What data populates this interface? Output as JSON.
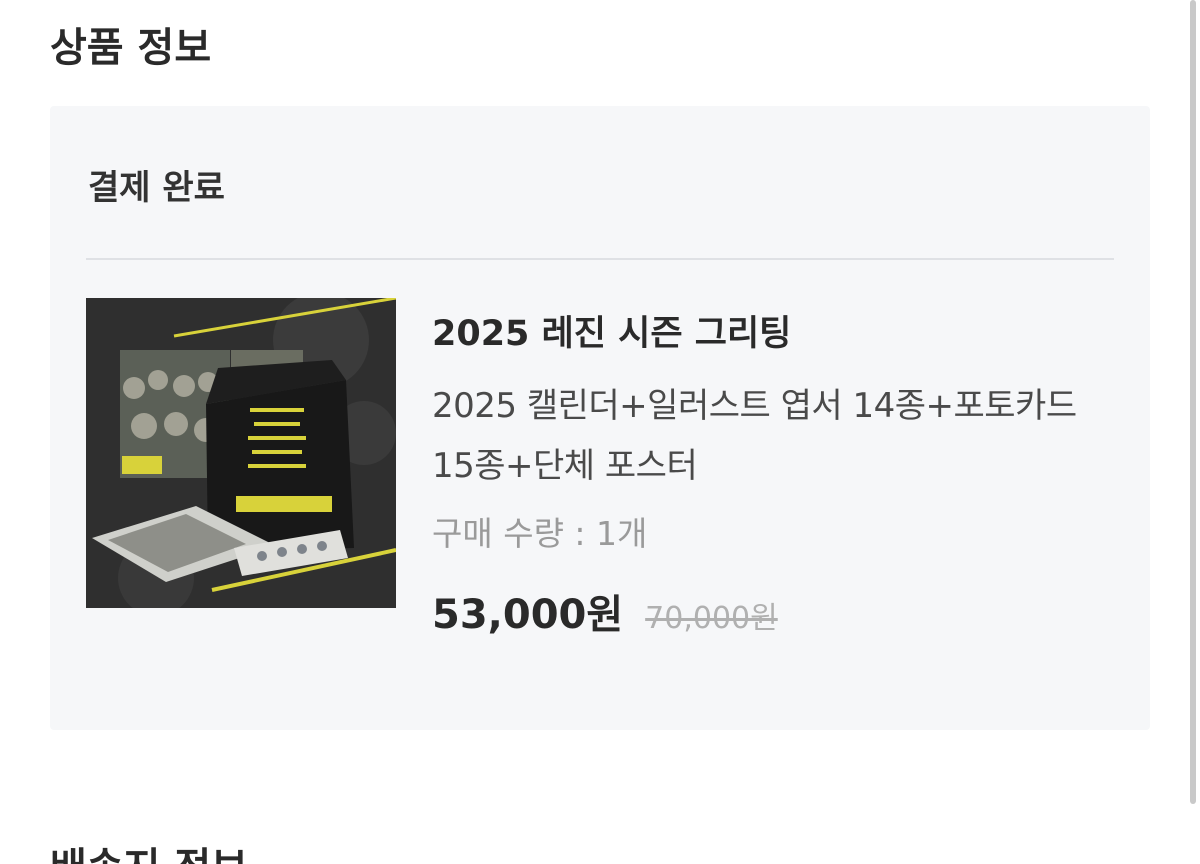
{
  "page": {
    "section_title": "상품 정보",
    "next_section_title": "배송지 정보"
  },
  "order": {
    "status": "결제 완료",
    "thumbnail_icon": "product-image",
    "product": {
      "name": "2025 레진 시즌 그리팅",
      "description": "2025 캘린더+일러스트 엽서 14종+포토카드 15종+단체 포스터",
      "quantity_label": "구매 수량 : ",
      "quantity_value": "1개",
      "price": "53,000원",
      "original_price": "70,000원"
    }
  },
  "colors": {
    "card_background": "#f6f7f9",
    "accent_yellow": "#d8d23a"
  }
}
